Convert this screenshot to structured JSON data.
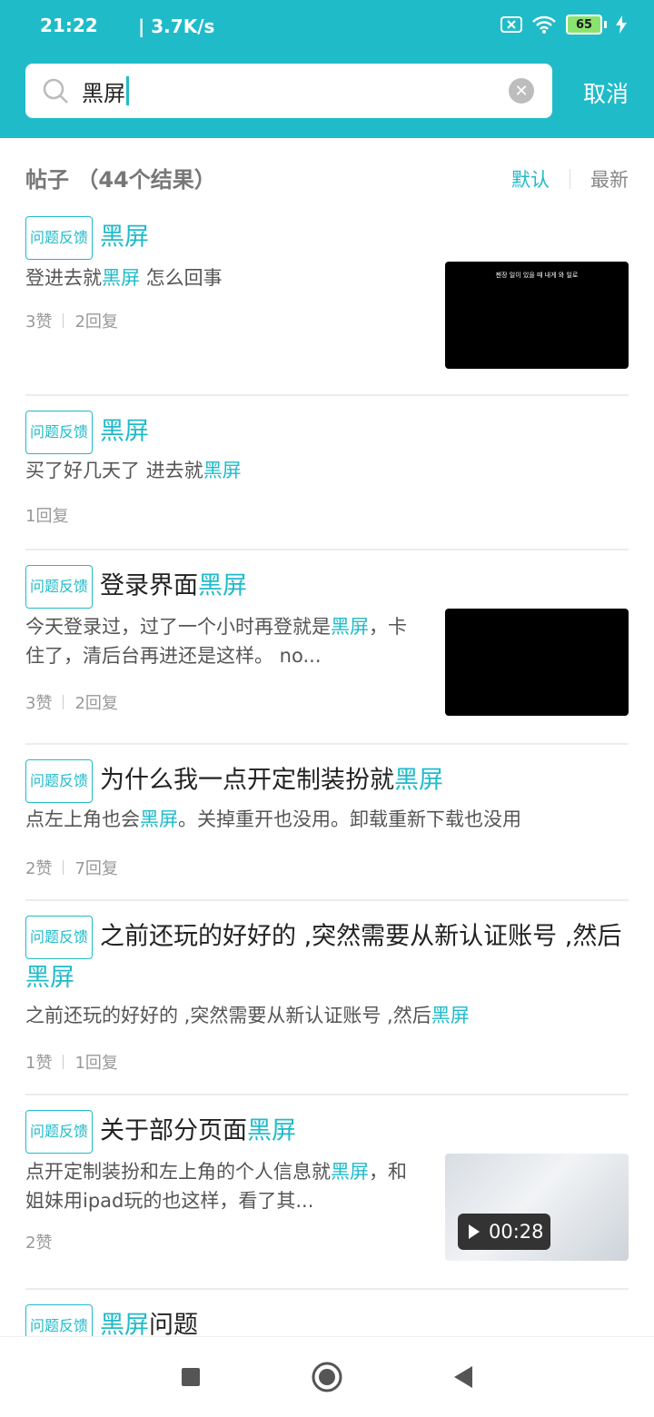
{
  "status": {
    "time": "21:22",
    "net": "| 3.7K/s",
    "battery": "65"
  },
  "search": {
    "query": "黑屏",
    "cancel": "取消"
  },
  "filter": {
    "label": "帖子 （44个结果）",
    "sort_default": "默认",
    "sort_latest": "最新"
  },
  "posts": [
    {
      "tag": "问题反馈",
      "title_pre": "",
      "title_hl": "黑屏",
      "title_post": "",
      "body_pre": "登进去就",
      "body_hl": "黑屏",
      "body_post": " 怎么回事",
      "likes": "3赞",
      "replies": "2回复",
      "thumb_caption": "젠장 일이 있을 때 내게 와 일로"
    },
    {
      "tag": "问题反馈",
      "title_pre": "",
      "title_hl": "黑屏",
      "title_post": "",
      "body_pre": "买了好几天了 进去就",
      "body_hl": "黑屏",
      "body_post": "",
      "replies": "1回复"
    },
    {
      "tag": "问题反馈",
      "title_pre": "登录界面",
      "title_hl": "黑屏",
      "title_post": "",
      "body_pre": "今天登录过，过了一个小时再登就是",
      "body_hl": "黑屏",
      "body_post": "，卡住了，清后台再进还是这样。 no...",
      "likes": "3赞",
      "replies": "2回复"
    },
    {
      "tag": "问题反馈",
      "title_pre": "为什么我一点开定制装扮就",
      "title_hl": "黑屏",
      "title_post": "",
      "body_pre": "点左上角也会",
      "body_hl": "黑屏",
      "body_post": "。关掉重开也没用。卸载重新下载也没用",
      "likes": "2赞",
      "replies": "7回复"
    },
    {
      "tag": "问题反馈",
      "title_pre": "之前还玩的好好的 ,突然需要从新认证账号 ,然后",
      "title_hl": "黑屏",
      "title_post": "",
      "body_pre": "之前还玩的好好的 ,突然需要从新认证账号 ,然后",
      "body_hl": "黑屏",
      "body_post": "",
      "likes": "1赞",
      "replies": "1回复"
    },
    {
      "tag": "问题反馈",
      "title_pre": "关于部分页面",
      "title_hl": "黑屏",
      "title_post": "",
      "body_pre": "点开定制装扮和左上角的个人信息就",
      "body_hl": "黑屏",
      "body_post": "，和姐妹用ipad玩的也这样，看了其...",
      "likes": "2赞",
      "video_duration": "00:28"
    },
    {
      "tag": "问题反馈",
      "title_pre": "",
      "title_hl": "黑屏",
      "title_post": "问题"
    }
  ],
  "colors": {
    "accent": "#20BBC9"
  }
}
